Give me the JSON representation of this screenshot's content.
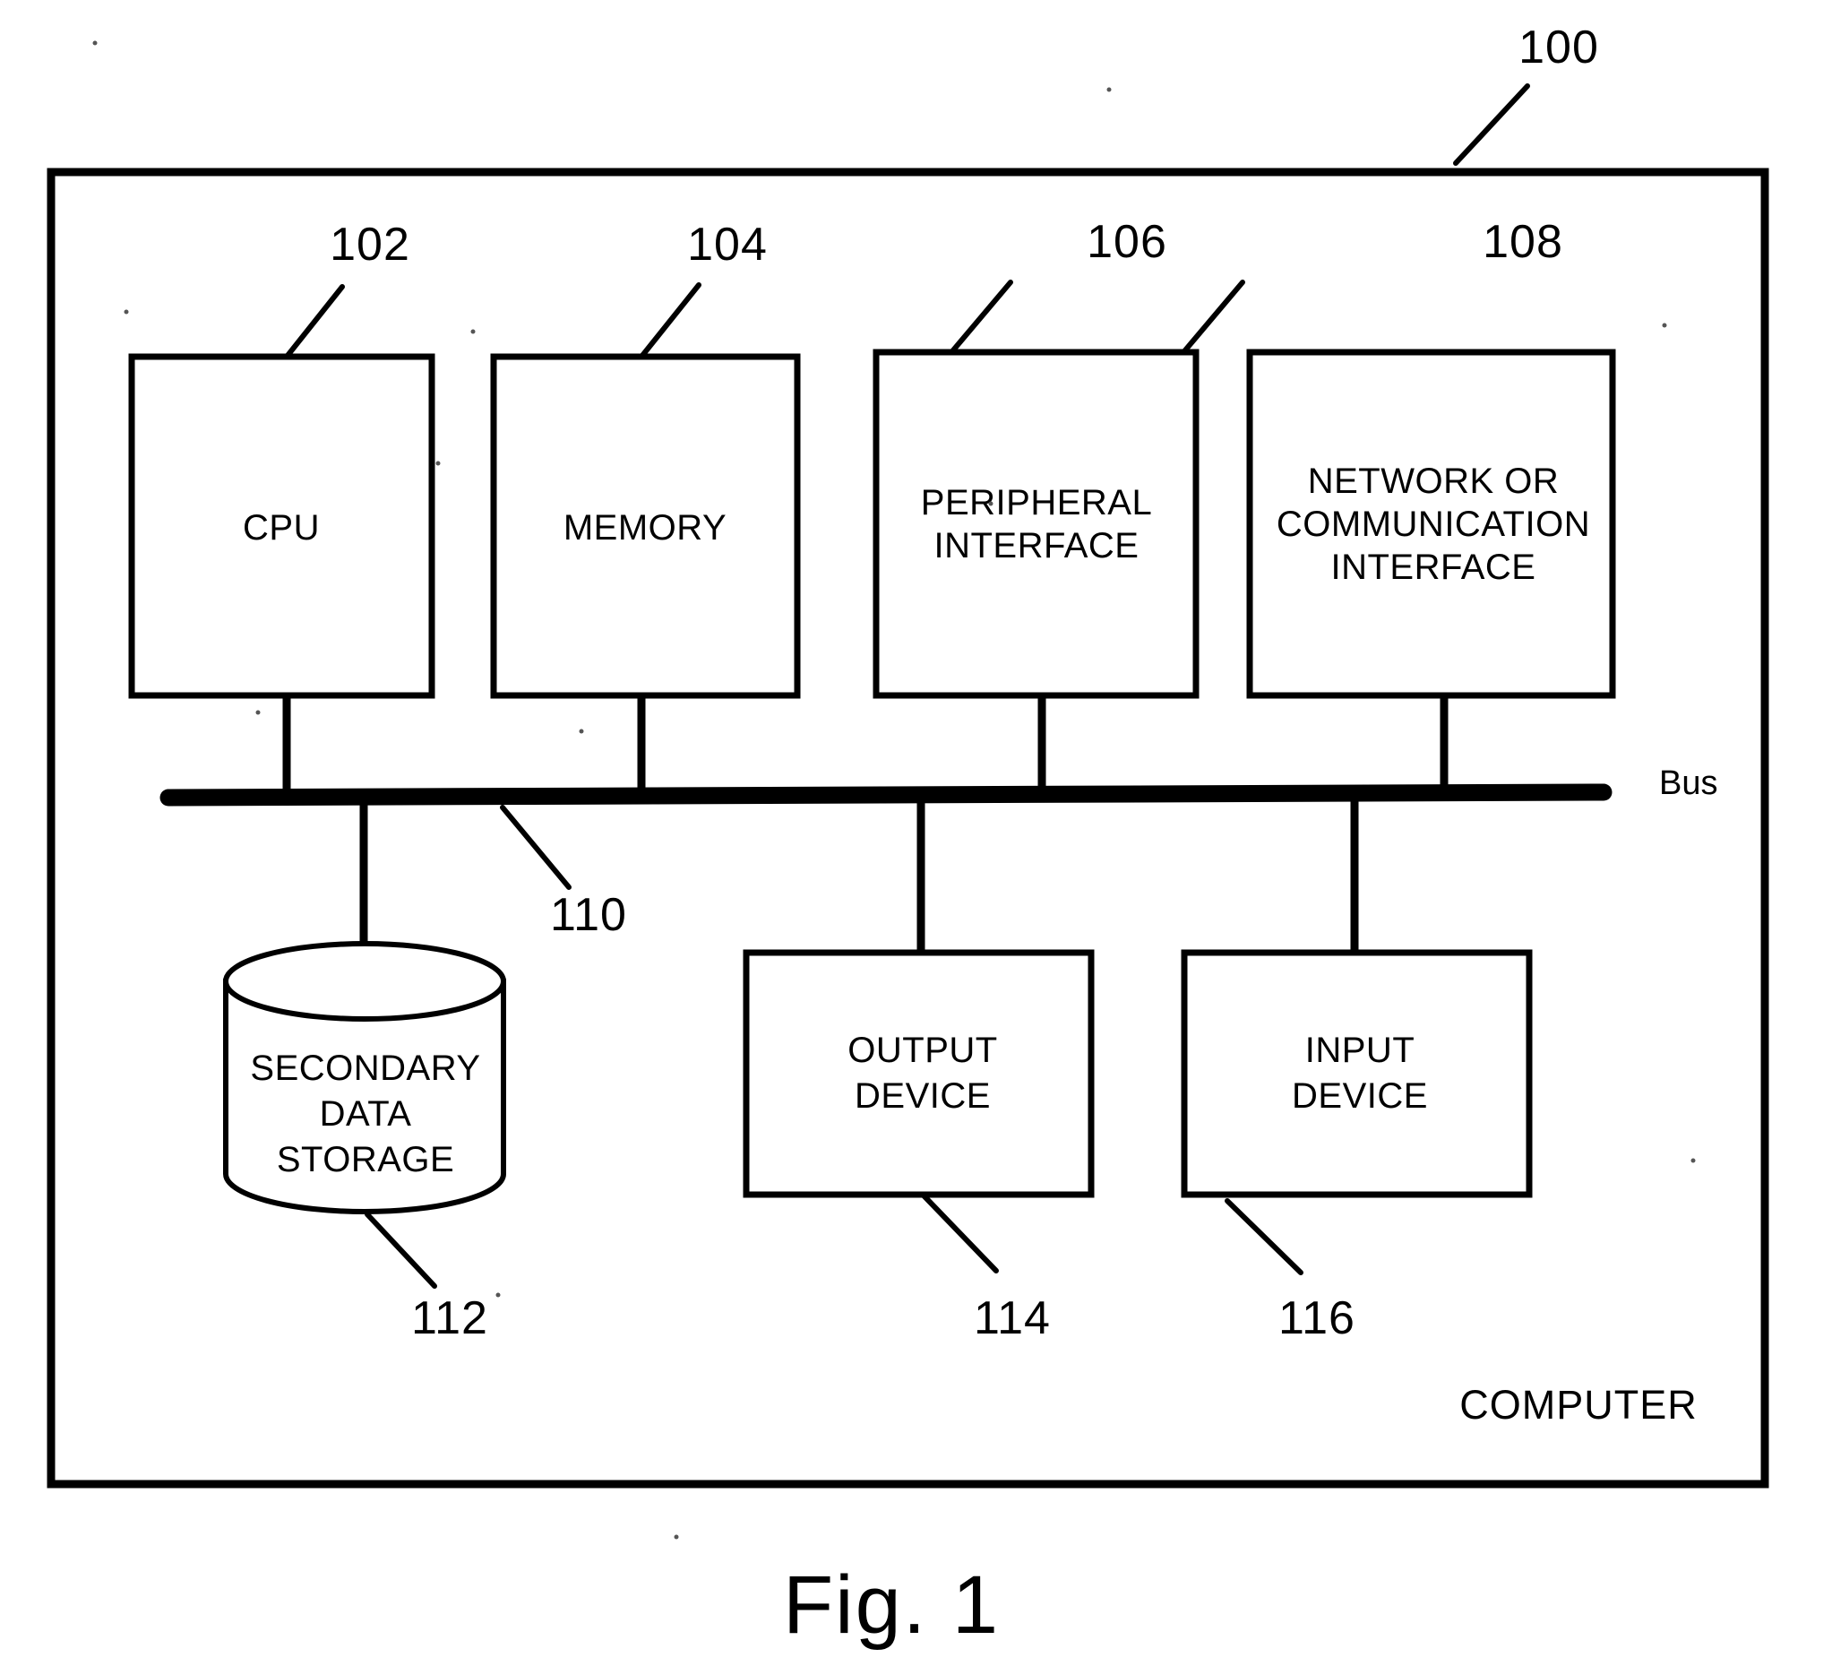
{
  "figure": {
    "caption": "Fig. 1",
    "frame_label": "COMPUTER",
    "frame_ref": "100",
    "bus_label": "Bus",
    "bus_ref": "110"
  },
  "blocks": [
    {
      "id": "cpu",
      "label_lines": [
        "CPU"
      ],
      "ref": "102"
    },
    {
      "id": "memory",
      "label_lines": [
        "MEMORY"
      ],
      "ref": "104"
    },
    {
      "id": "peripheral",
      "label_lines": [
        "PERIPHERAL",
        "INTERFACE"
      ],
      "ref": "106"
    },
    {
      "id": "network",
      "label_lines": [
        "NETWORK OR",
        "COMMUNICATION",
        "INTERFACE"
      ],
      "ref": "108"
    },
    {
      "id": "storage",
      "label_lines": [
        "SECONDARY",
        "DATA",
        "STORAGE"
      ],
      "ref": "112"
    },
    {
      "id": "output",
      "label_lines": [
        "OUTPUT",
        "DEVICE"
      ],
      "ref": "114"
    },
    {
      "id": "input",
      "label_lines": [
        "INPUT",
        "DEVICE"
      ],
      "ref": "116"
    }
  ],
  "colors": {
    "ink": "#000000",
    "paper": "#ffffff"
  }
}
